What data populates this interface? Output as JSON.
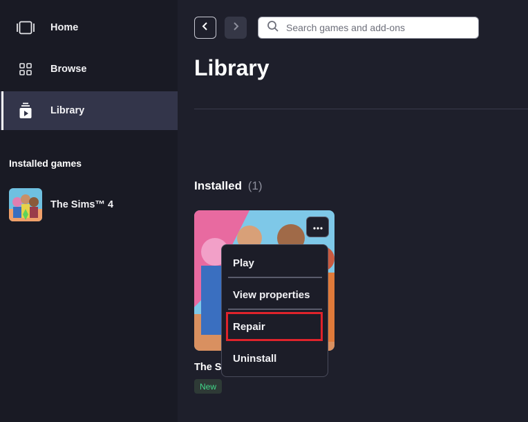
{
  "sidebar": {
    "items": [
      {
        "label": "Home",
        "icon": "home-icon"
      },
      {
        "label": "Browse",
        "icon": "grid-icon"
      },
      {
        "label": "Library",
        "icon": "library-icon",
        "active": true
      }
    ],
    "installed_title": "Installed games",
    "installed_games": [
      {
        "label": "The Sims™ 4"
      }
    ]
  },
  "toolbar": {
    "back_icon": "chevron-left-icon",
    "forward_icon": "chevron-right-icon",
    "search_placeholder": "Search games and add-ons"
  },
  "main": {
    "title": "Library",
    "installed_label": "Installed",
    "installed_count": "(1)",
    "card": {
      "title_visible": "The S",
      "badge": "New"
    }
  },
  "context_menu": {
    "items": [
      "Play",
      "View properties",
      "Repair",
      "Uninstall"
    ],
    "highlighted": "Repair"
  },
  "colors": {
    "background": "#1e1f2b",
    "sidebar": "#191a24",
    "active_item": "#33354a",
    "badge_text": "#41d98a",
    "highlight": "#e0232b"
  }
}
